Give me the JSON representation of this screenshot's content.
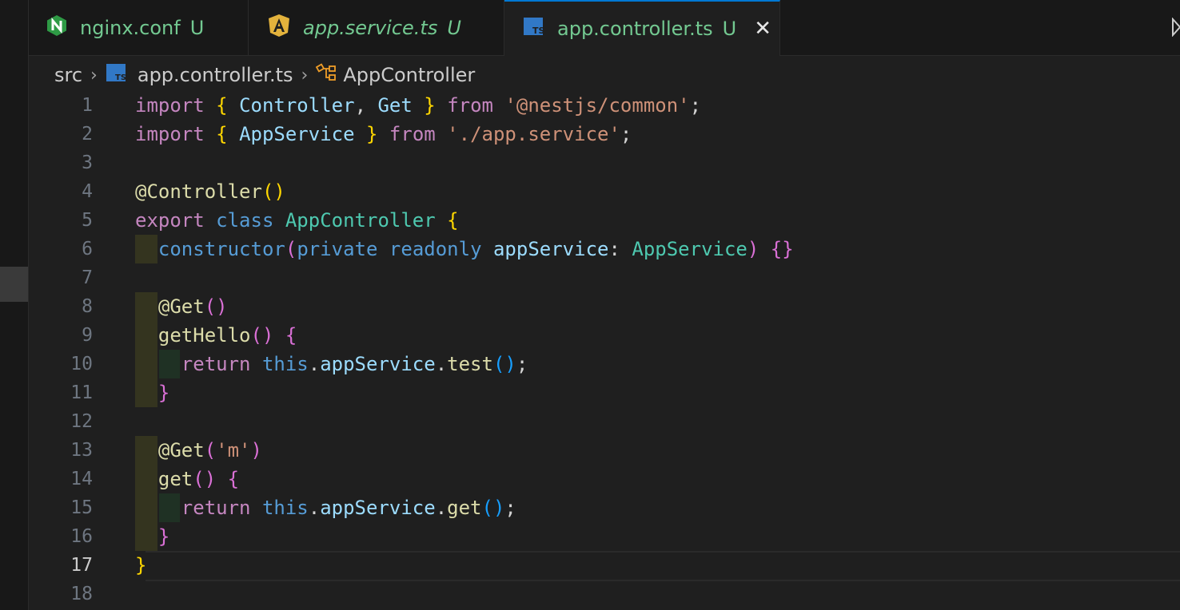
{
  "tabs": [
    {
      "name": "nginx.conf",
      "status": "U",
      "icon": "nginx-icon"
    },
    {
      "name": "app.service.ts",
      "status": "U",
      "icon": "angular-icon"
    },
    {
      "name": "app.controller.ts",
      "status": "U",
      "icon": "typescript-icon",
      "active": true,
      "close": "✕"
    }
  ],
  "breadcrumb": {
    "folder": "src",
    "file": "app.controller.ts",
    "symbol": "AppController",
    "sep": "›"
  },
  "editor": {
    "active_line": 17,
    "line_numbers": [
      "1",
      "2",
      "3",
      "4",
      "5",
      "6",
      "7",
      "8",
      "9",
      "10",
      "11",
      "12",
      "13",
      "14",
      "15",
      "16",
      "17",
      "18"
    ],
    "lines": [
      "import { Controller, Get } from '@nestjs/common';",
      "import { AppService } from './app.service';",
      "",
      "@Controller()",
      "export class AppController {",
      "  constructor(private readonly appService: AppService) {}",
      "",
      "  @Get()",
      "  getHello() {",
      "    return this.appService.test();",
      "  }",
      "",
      "  @Get('m')",
      "  get() {",
      "    return this.appService.get();",
      "  }",
      "}",
      ""
    ]
  },
  "colors": {
    "keyword": "#c586c0",
    "storage": "#569cd6",
    "string": "#ce9178",
    "variable": "#9cdcfe",
    "function": "#dcdcaa",
    "type": "#4ec9b0",
    "status_untracked": "#73c991",
    "tab_active_border": "#0078d4"
  }
}
